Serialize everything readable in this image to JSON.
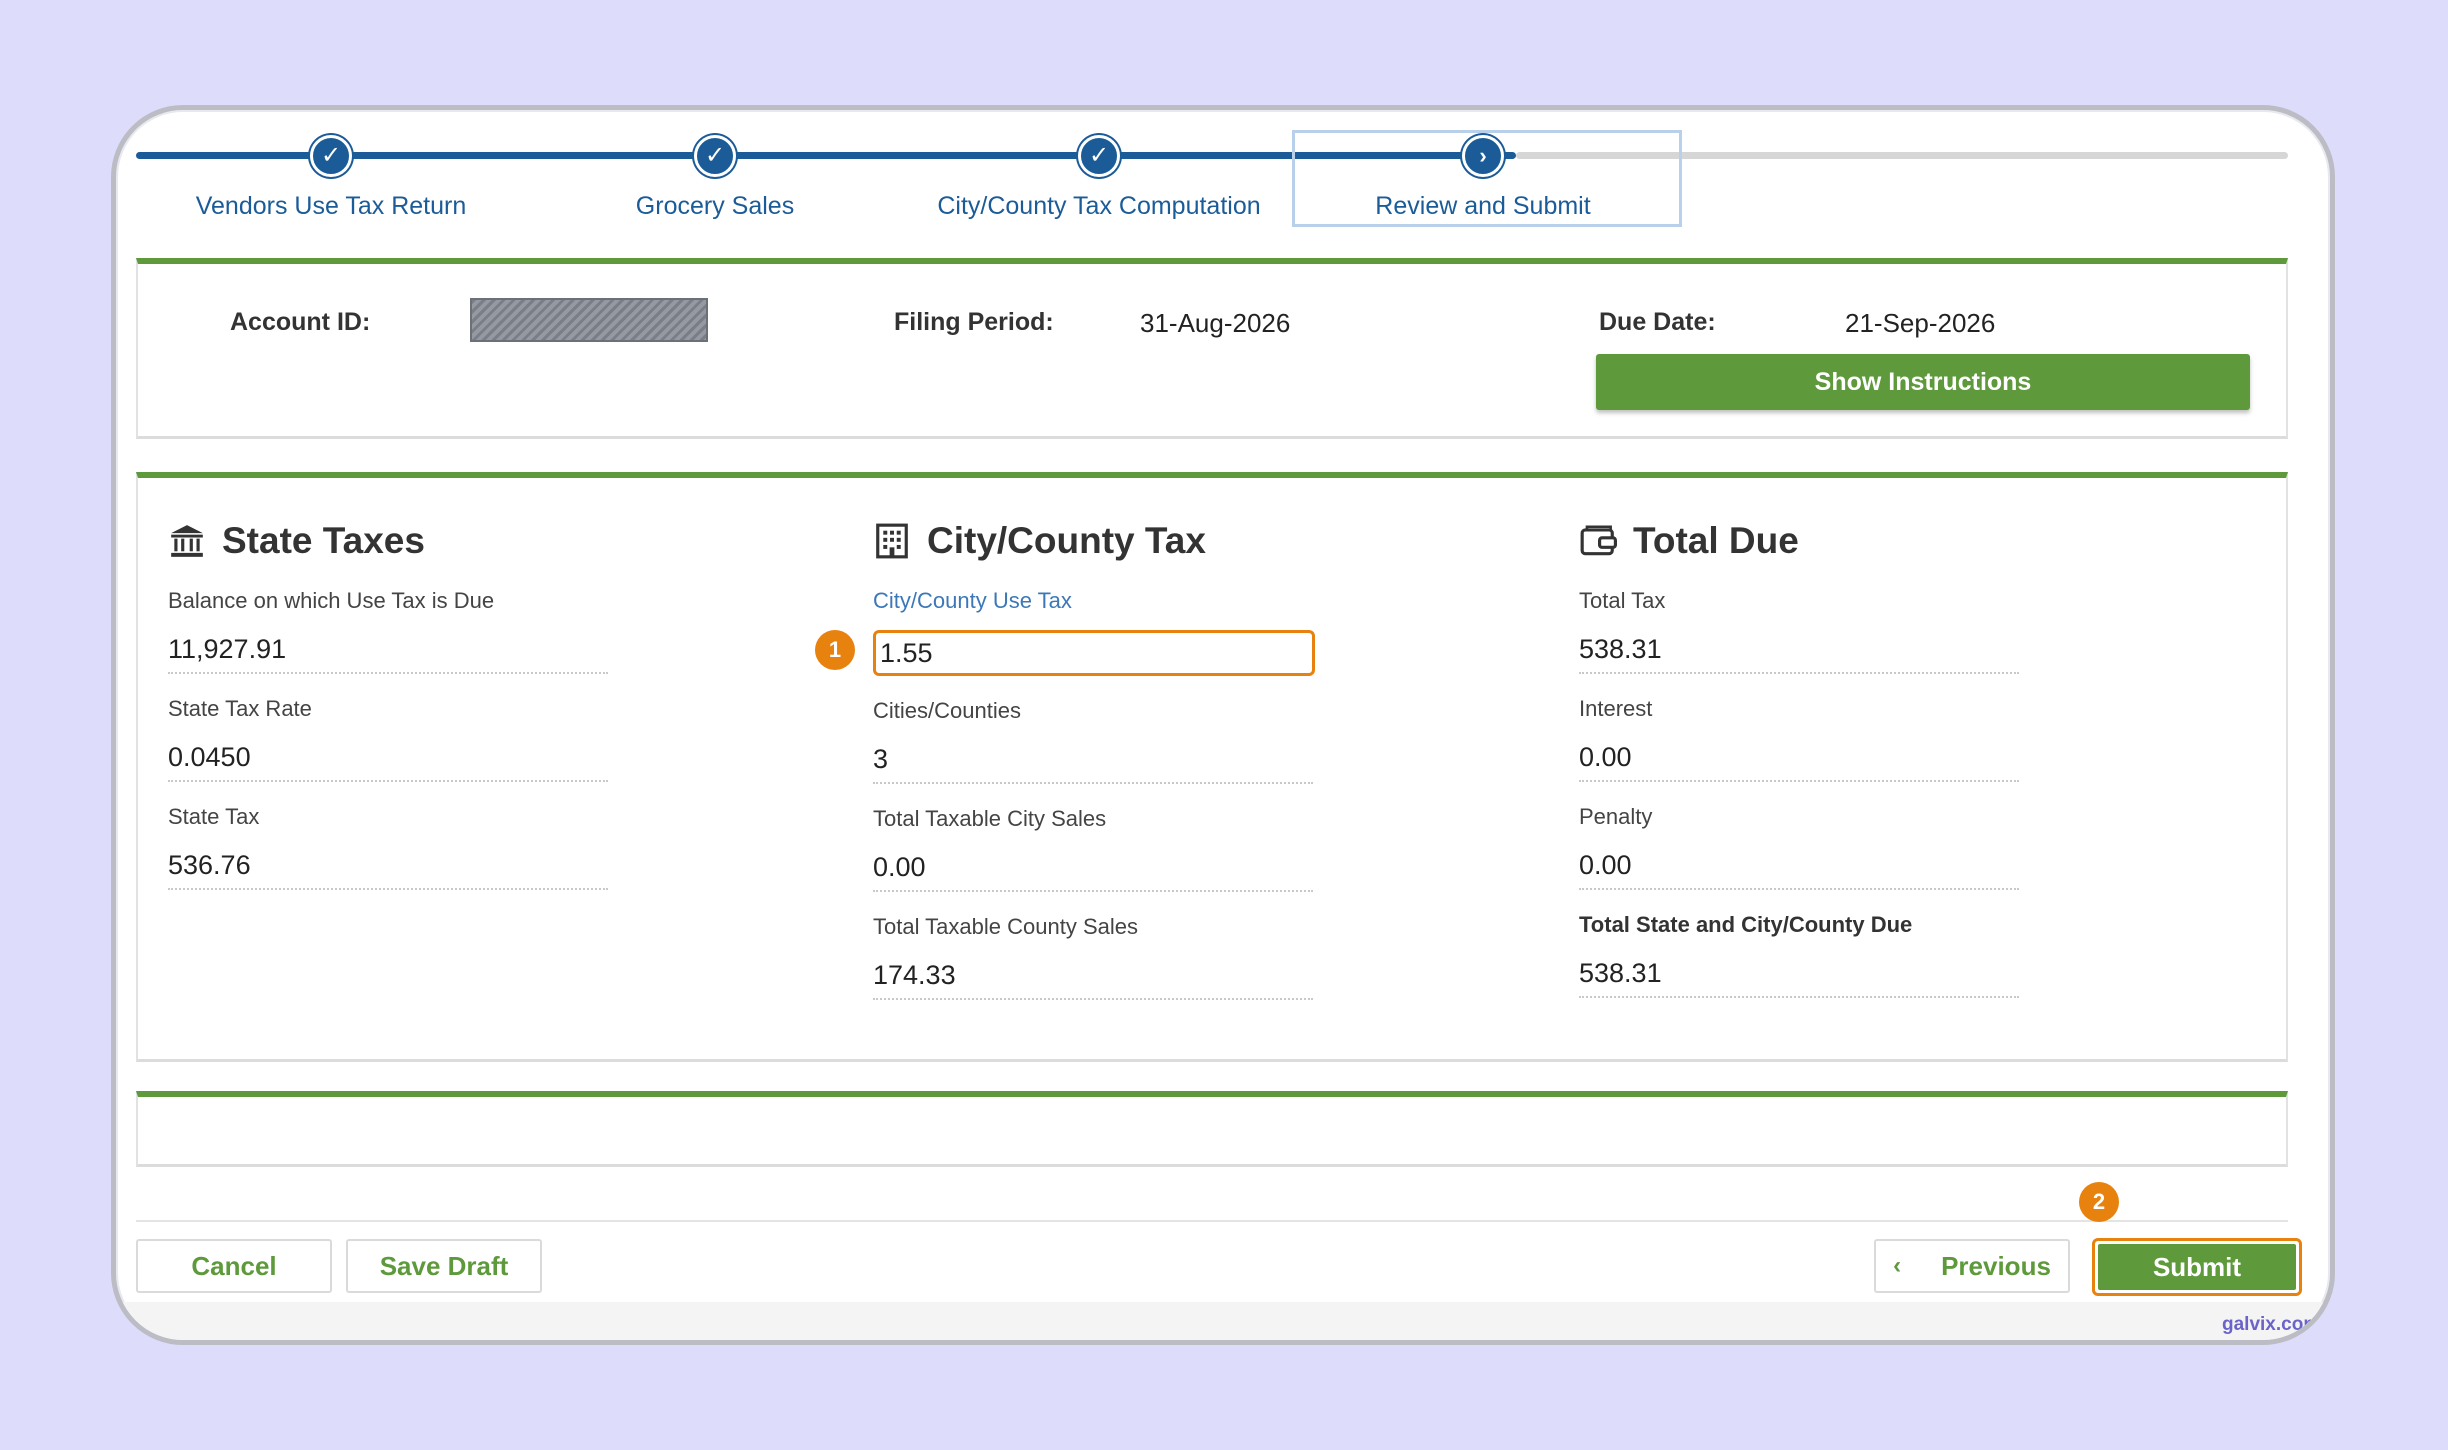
{
  "stepper": {
    "steps": [
      {
        "label": "Vendors Use Tax Return",
        "status": "complete"
      },
      {
        "label": "Grocery Sales",
        "status": "complete"
      },
      {
        "label": "City/County Tax Computation",
        "status": "complete"
      },
      {
        "label": "Review and Submit",
        "status": "current"
      }
    ]
  },
  "account": {
    "account_id_label": "Account ID:",
    "filing_period_label": "Filing Period:",
    "filing_period_value": "31-Aug-2026",
    "due_date_label": "Due Date:",
    "due_date_value": "21-Sep-2026",
    "show_instructions_label": "Show Instructions"
  },
  "state_taxes": {
    "title": "State Taxes",
    "icon": "bank-icon",
    "fields": [
      {
        "label": "Balance on which Use Tax is Due",
        "value": "11,927.91"
      },
      {
        "label": "State Tax Rate",
        "value": "0.0450"
      },
      {
        "label": "State Tax",
        "value": "536.76"
      }
    ]
  },
  "city_county": {
    "title": "City/County Tax",
    "icon": "building-icon",
    "use_tax_label": "City/County Use Tax",
    "use_tax_value": "1.55",
    "fields": [
      {
        "label": "Cities/Counties",
        "value": "3"
      },
      {
        "label": "Total Taxable City Sales",
        "value": "0.00"
      },
      {
        "label": "Total Taxable County Sales",
        "value": "174.33"
      }
    ]
  },
  "total_due": {
    "title": "Total Due",
    "icon": "wallet-icon",
    "fields": [
      {
        "label": "Total Tax",
        "value": "538.31"
      },
      {
        "label": "Interest",
        "value": "0.00"
      },
      {
        "label": "Penalty",
        "value": "0.00"
      },
      {
        "label": "Total State and City/County Due",
        "value": "538.31"
      }
    ]
  },
  "badges": {
    "one": "1",
    "two": "2"
  },
  "footer": {
    "cancel_label": "Cancel",
    "save_draft_label": "Save Draft",
    "previous_label": "Previous",
    "submit_label": "Submit"
  },
  "watermark": "galvix.com",
  "colors": {
    "primary_blue": "#1b5c98",
    "accent_green": "#5e9a3c",
    "highlight_orange": "#e8820e",
    "background": "#dddcfb"
  }
}
